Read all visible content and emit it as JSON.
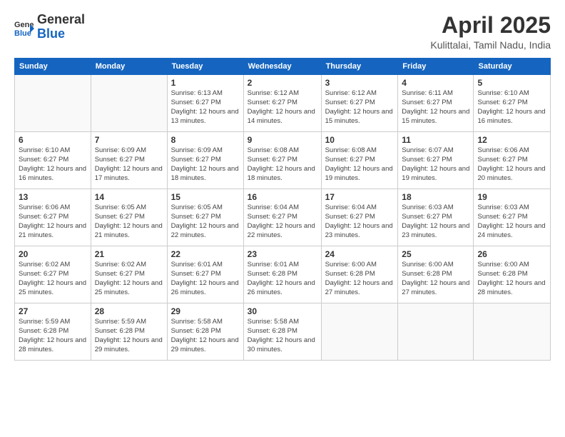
{
  "header": {
    "logo_line1": "General",
    "logo_line2": "Blue",
    "month": "April 2025",
    "location": "Kulittalai, Tamil Nadu, India"
  },
  "weekdays": [
    "Sunday",
    "Monday",
    "Tuesday",
    "Wednesday",
    "Thursday",
    "Friday",
    "Saturday"
  ],
  "weeks": [
    [
      {
        "day": "",
        "detail": ""
      },
      {
        "day": "",
        "detail": ""
      },
      {
        "day": "1",
        "detail": "Sunrise: 6:13 AM\nSunset: 6:27 PM\nDaylight: 12 hours and 13 minutes."
      },
      {
        "day": "2",
        "detail": "Sunrise: 6:12 AM\nSunset: 6:27 PM\nDaylight: 12 hours and 14 minutes."
      },
      {
        "day": "3",
        "detail": "Sunrise: 6:12 AM\nSunset: 6:27 PM\nDaylight: 12 hours and 15 minutes."
      },
      {
        "day": "4",
        "detail": "Sunrise: 6:11 AM\nSunset: 6:27 PM\nDaylight: 12 hours and 15 minutes."
      },
      {
        "day": "5",
        "detail": "Sunrise: 6:10 AM\nSunset: 6:27 PM\nDaylight: 12 hours and 16 minutes."
      }
    ],
    [
      {
        "day": "6",
        "detail": "Sunrise: 6:10 AM\nSunset: 6:27 PM\nDaylight: 12 hours and 16 minutes."
      },
      {
        "day": "7",
        "detail": "Sunrise: 6:09 AM\nSunset: 6:27 PM\nDaylight: 12 hours and 17 minutes."
      },
      {
        "day": "8",
        "detail": "Sunrise: 6:09 AM\nSunset: 6:27 PM\nDaylight: 12 hours and 18 minutes."
      },
      {
        "day": "9",
        "detail": "Sunrise: 6:08 AM\nSunset: 6:27 PM\nDaylight: 12 hours and 18 minutes."
      },
      {
        "day": "10",
        "detail": "Sunrise: 6:08 AM\nSunset: 6:27 PM\nDaylight: 12 hours and 19 minutes."
      },
      {
        "day": "11",
        "detail": "Sunrise: 6:07 AM\nSunset: 6:27 PM\nDaylight: 12 hours and 19 minutes."
      },
      {
        "day": "12",
        "detail": "Sunrise: 6:06 AM\nSunset: 6:27 PM\nDaylight: 12 hours and 20 minutes."
      }
    ],
    [
      {
        "day": "13",
        "detail": "Sunrise: 6:06 AM\nSunset: 6:27 PM\nDaylight: 12 hours and 21 minutes."
      },
      {
        "day": "14",
        "detail": "Sunrise: 6:05 AM\nSunset: 6:27 PM\nDaylight: 12 hours and 21 minutes."
      },
      {
        "day": "15",
        "detail": "Sunrise: 6:05 AM\nSunset: 6:27 PM\nDaylight: 12 hours and 22 minutes."
      },
      {
        "day": "16",
        "detail": "Sunrise: 6:04 AM\nSunset: 6:27 PM\nDaylight: 12 hours and 22 minutes."
      },
      {
        "day": "17",
        "detail": "Sunrise: 6:04 AM\nSunset: 6:27 PM\nDaylight: 12 hours and 23 minutes."
      },
      {
        "day": "18",
        "detail": "Sunrise: 6:03 AM\nSunset: 6:27 PM\nDaylight: 12 hours and 23 minutes."
      },
      {
        "day": "19",
        "detail": "Sunrise: 6:03 AM\nSunset: 6:27 PM\nDaylight: 12 hours and 24 minutes."
      }
    ],
    [
      {
        "day": "20",
        "detail": "Sunrise: 6:02 AM\nSunset: 6:27 PM\nDaylight: 12 hours and 25 minutes."
      },
      {
        "day": "21",
        "detail": "Sunrise: 6:02 AM\nSunset: 6:27 PM\nDaylight: 12 hours and 25 minutes."
      },
      {
        "day": "22",
        "detail": "Sunrise: 6:01 AM\nSunset: 6:27 PM\nDaylight: 12 hours and 26 minutes."
      },
      {
        "day": "23",
        "detail": "Sunrise: 6:01 AM\nSunset: 6:28 PM\nDaylight: 12 hours and 26 minutes."
      },
      {
        "day": "24",
        "detail": "Sunrise: 6:00 AM\nSunset: 6:28 PM\nDaylight: 12 hours and 27 minutes."
      },
      {
        "day": "25",
        "detail": "Sunrise: 6:00 AM\nSunset: 6:28 PM\nDaylight: 12 hours and 27 minutes."
      },
      {
        "day": "26",
        "detail": "Sunrise: 6:00 AM\nSunset: 6:28 PM\nDaylight: 12 hours and 28 minutes."
      }
    ],
    [
      {
        "day": "27",
        "detail": "Sunrise: 5:59 AM\nSunset: 6:28 PM\nDaylight: 12 hours and 28 minutes."
      },
      {
        "day": "28",
        "detail": "Sunrise: 5:59 AM\nSunset: 6:28 PM\nDaylight: 12 hours and 29 minutes."
      },
      {
        "day": "29",
        "detail": "Sunrise: 5:58 AM\nSunset: 6:28 PM\nDaylight: 12 hours and 29 minutes."
      },
      {
        "day": "30",
        "detail": "Sunrise: 5:58 AM\nSunset: 6:28 PM\nDaylight: 12 hours and 30 minutes."
      },
      {
        "day": "",
        "detail": ""
      },
      {
        "day": "",
        "detail": ""
      },
      {
        "day": "",
        "detail": ""
      }
    ]
  ]
}
